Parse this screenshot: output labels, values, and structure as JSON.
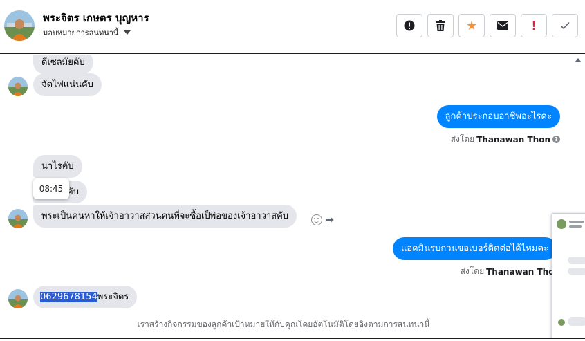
{
  "header": {
    "name": "พระจิตร เกษตร บุญหาร",
    "assignee": "มอบหมายการสนทนานี้",
    "actions": [
      {
        "name": "spam-button",
        "icon": "alert-circle-icon"
      },
      {
        "name": "delete-button",
        "icon": "trash-icon"
      },
      {
        "name": "star-button",
        "icon": "star-icon"
      },
      {
        "name": "mark-unread-button",
        "icon": "envelope-icon"
      },
      {
        "name": "follow-up-button",
        "icon": "exclamation-icon"
      },
      {
        "name": "mark-done-button",
        "icon": "checkmark-icon"
      }
    ]
  },
  "messages": {
    "m1": "ดีเซลมัยคับ",
    "m2": "จัดไฟแน่นคับ",
    "m3": "ลูกค้าประกอบอาชีพอะไรคะ",
    "m3_sent_prefix": "ส่งโดย",
    "m3_sender": "Thanawan Thon",
    "m4": "นาไรคับ",
    "m5": "คับ",
    "m5_tooltip": "08:45",
    "m6": "พระเป็นคนหาให้เจ้าอาวาสส่วนคนที่จะซื้อเป็พ่อของเจ้าอาวาสคับ",
    "m7": "แอดมินรบกวนขอเบอร์ติดต่อได้ไหมคะ",
    "m7_sent_prefix": "ส่งโดย",
    "m7_sender": "Thanawan Thon",
    "m8_selected": "0629678154",
    "m8_rest": "พระจิตร"
  },
  "footer_note": "เราสร้างกิจกรรมของลูกค้าเป้าหมายให้กับคุณโดยอัตโนมัติโดยอิงตามการสนทนานี้",
  "colors": {
    "outgoing_bubble": "#0084ff",
    "incoming_bubble": "#e4e6eb",
    "star": "#f7923a",
    "alert": "#e41e3f",
    "selection": "#2a5bd7"
  }
}
